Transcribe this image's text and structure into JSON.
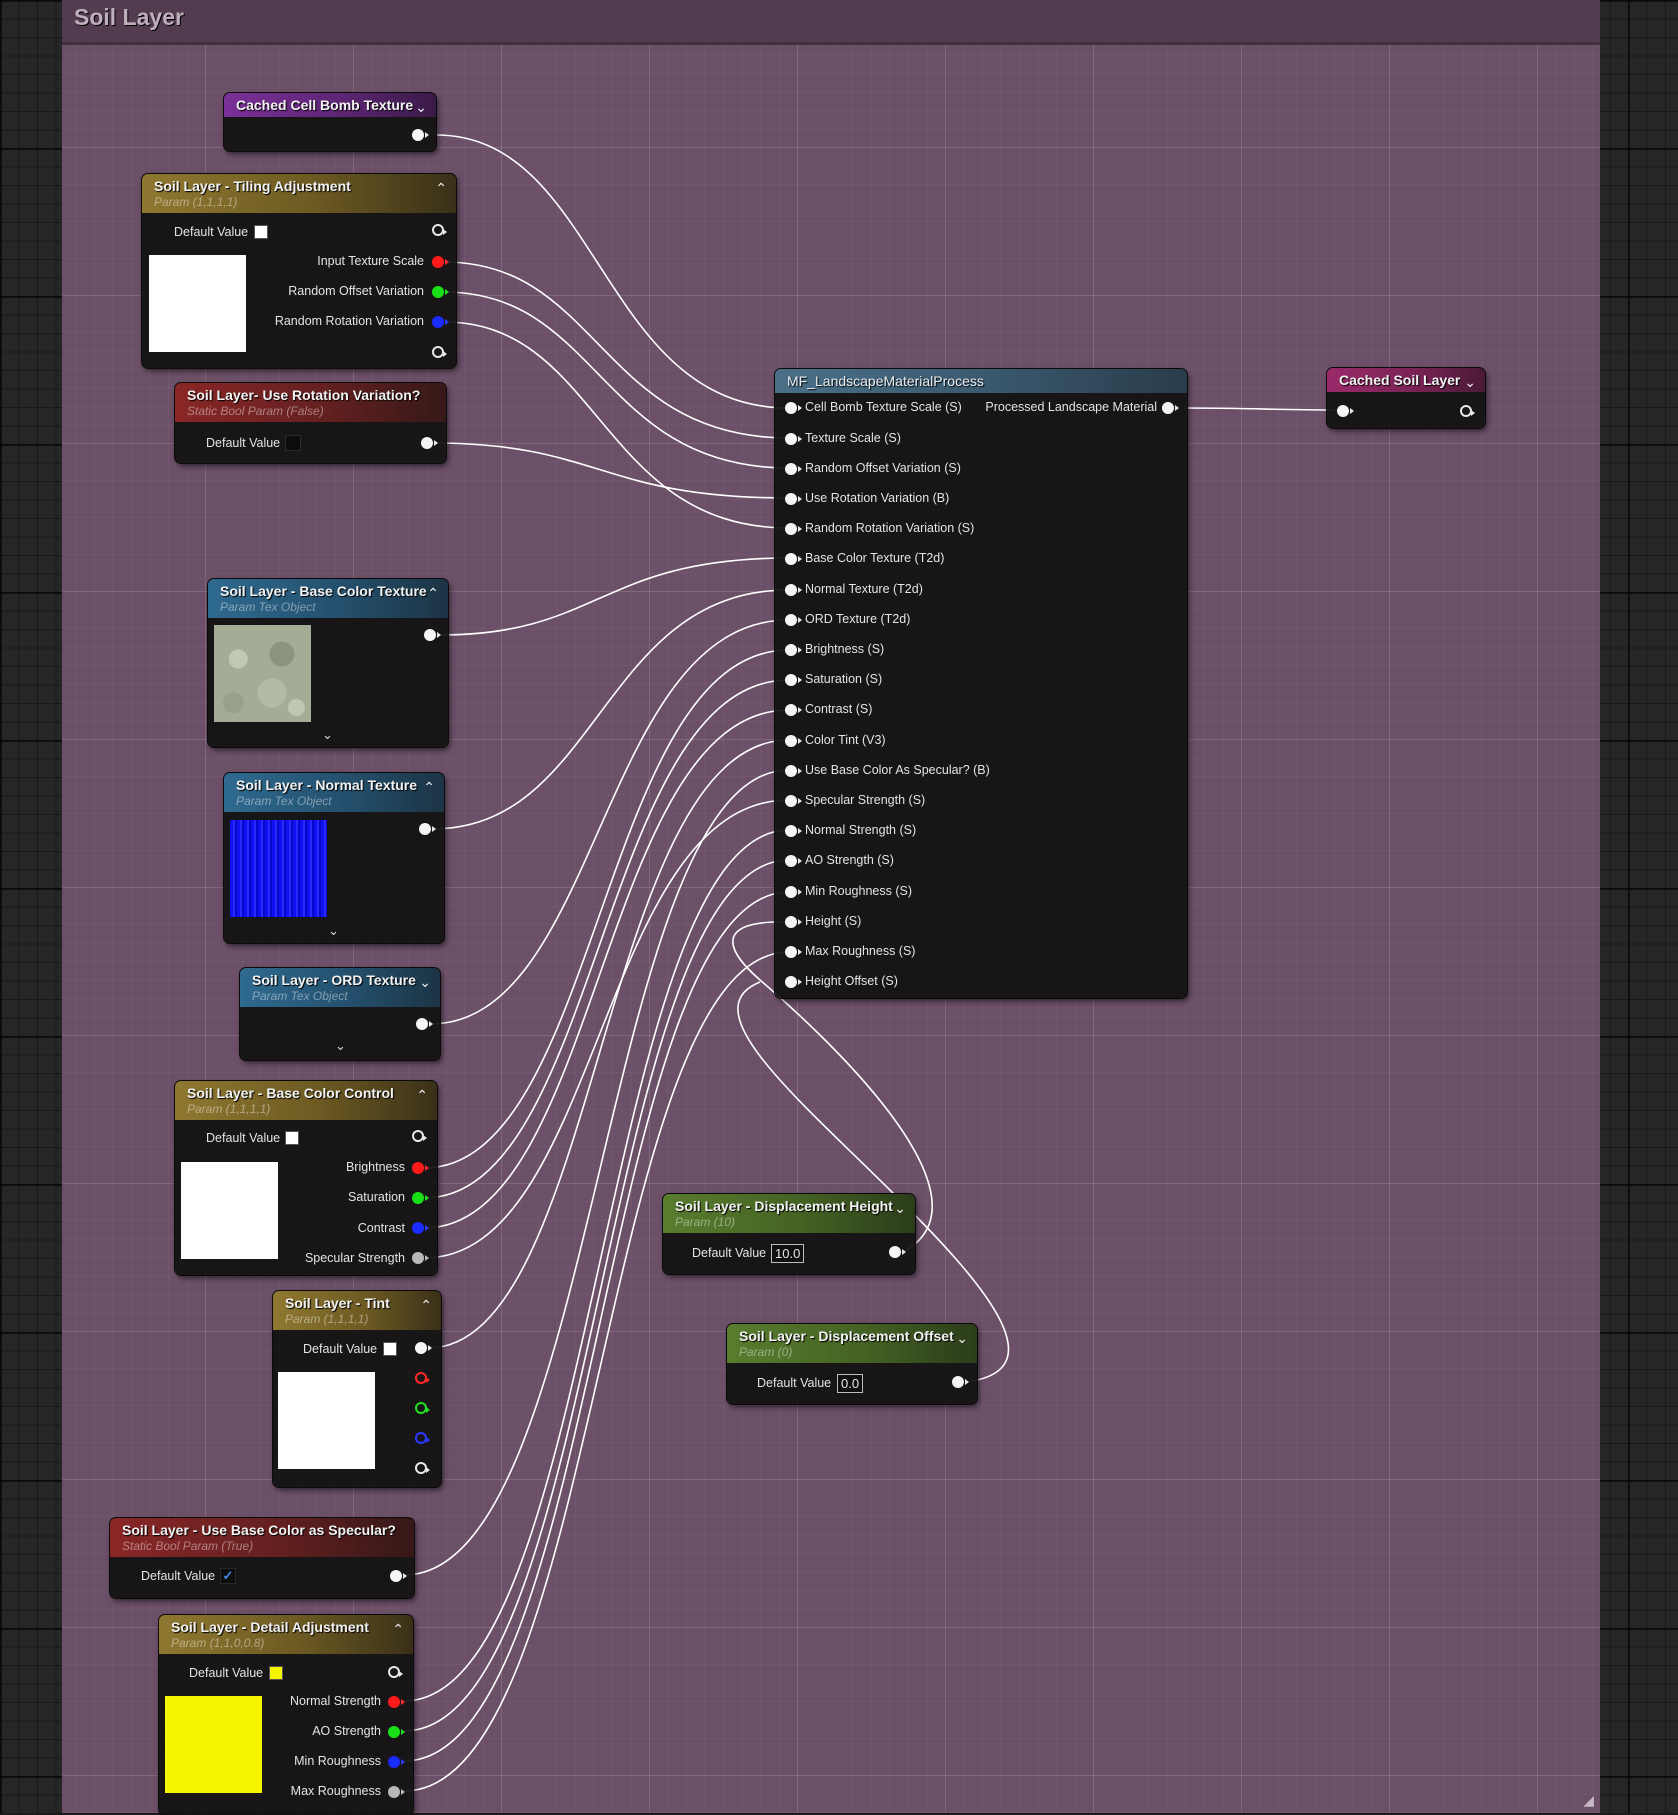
{
  "comment": {
    "title": "Soil Layer"
  },
  "nodes": {
    "cached_cell_bomb": {
      "title": "Cached Cell Bomb Texture"
    },
    "tiling": {
      "title": "Soil Layer - Tiling Adjustment",
      "subtitle": "Param (1,1,1,1)",
      "default_label": "Default Value",
      "default_color": "#ffffff",
      "pins": [
        "Input Texture Scale",
        "Random Offset Variation",
        "Random Rotation Variation"
      ]
    },
    "rotation": {
      "title": "Soil Layer- Use Rotation Variation?",
      "subtitle": "Static Bool Param (False)",
      "default_label": "Default Value",
      "checked": false
    },
    "base_color_tex": {
      "title": "Soil Layer - Base Color Texture",
      "subtitle": "Param Tex Object"
    },
    "normal_tex": {
      "title": "Soil Layer - Normal Texture",
      "subtitle": "Param Tex Object"
    },
    "ord_tex": {
      "title": "Soil Layer - ORD Texture",
      "subtitle": "Param Tex Object"
    },
    "base_color_control": {
      "title": "Soil Layer - Base Color Control",
      "subtitle": "Param (1,1,1,1)",
      "default_label": "Default Value",
      "default_color": "#ffffff",
      "pins": [
        "Brightness",
        "Saturation",
        "Contrast",
        "Specular Strength"
      ]
    },
    "tint": {
      "title": "Soil Layer - Tint",
      "subtitle": "Param (1,1,1,1)",
      "default_label": "Default Value",
      "default_color": "#ffffff"
    },
    "specular": {
      "title": "Soil Layer -  Use Base Color as Specular?",
      "subtitle": "Static Bool Param (True)",
      "default_label": "Default Value",
      "checked": true,
      "check_glyph": "✓"
    },
    "detail": {
      "title": "Soil Layer - Detail Adjustment",
      "subtitle": "Param (1,1,0,0.8)",
      "default_label": "Default Value",
      "default_color": "#f5f500",
      "pins": [
        "Normal Strength",
        "AO Strength",
        "Min Roughness",
        "Max Roughness"
      ]
    },
    "disp_height": {
      "title": "Soil Layer - Displacement Height",
      "subtitle": "Param (10)",
      "default_label": "Default Value",
      "value": "10.0"
    },
    "disp_offset": {
      "title": "Soil Layer - Displacement Offset",
      "subtitle": "Param (0)",
      "default_label": "Default Value",
      "value": "0.0"
    },
    "mf": {
      "title": "MF_LandscapeMaterialProcess",
      "output": "Processed Landscape Material",
      "inputs": [
        "Cell Bomb Texture Scale (S)",
        "Texture Scale (S)",
        "Random Offset Variation (S)",
        "Use Rotation Variation (B)",
        "Random Rotation Variation (S)",
        "Base Color Texture (T2d)",
        "Normal Texture (T2d)",
        "ORD Texture (T2d)",
        "Brightness (S)",
        "Saturation (S)",
        "Contrast (S)",
        "Color Tint (V3)",
        "Use  Base Color As Specular? (B)",
        "Specular Strength (S)",
        "Normal Strength (S)",
        "AO Strength (S)",
        "Min Roughness (S)",
        "Height (S)",
        "Max Roughness (S)",
        "Height Offset (S)"
      ]
    },
    "cached_soil": {
      "title": "Cached Soil Layer"
    }
  },
  "colors": {
    "comment_bg": "#6c5068",
    "wire": "#ffffff",
    "pin_red": "#ff1a1a",
    "pin_green": "#18e018",
    "pin_blue": "#1a2cff"
  },
  "icons": {
    "collapse": "chevron-up-icon",
    "expand": "chevron-down-icon",
    "resize": "resize-grip-icon"
  }
}
